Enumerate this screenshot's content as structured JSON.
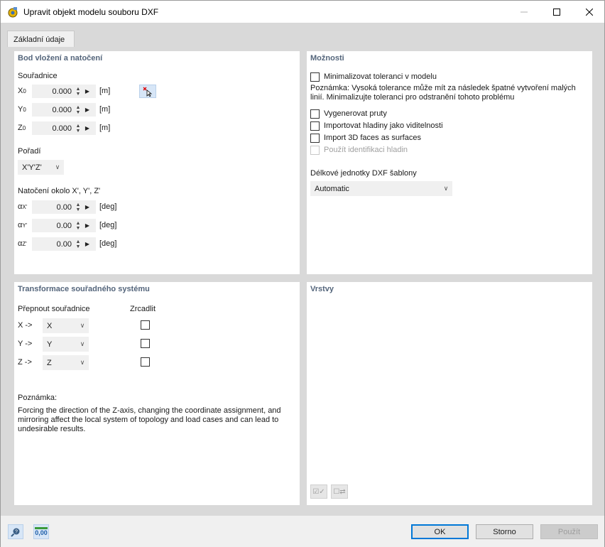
{
  "window": {
    "title": "Upravit objekt modelu souboru DXF",
    "tab": "Základní údaje"
  },
  "insert": {
    "title": "Bod vložení a natočení",
    "coords_label": "Souřadnice",
    "coords": [
      {
        "axis": "X",
        "sub": "0",
        "value": "0.000",
        "unit": "[m]"
      },
      {
        "axis": "Y",
        "sub": "0",
        "value": "0.000",
        "unit": "[m]"
      },
      {
        "axis": "Z",
        "sub": "0",
        "value": "0.000",
        "unit": "[m]"
      }
    ],
    "order_label": "Pořadí",
    "order_value": "X'Y'Z'",
    "rotation_label": "Natočení okolo X', Y', Z'",
    "rotations": [
      {
        "axis": "α",
        "sub": "X'",
        "value": "0.00",
        "unit": "[deg]"
      },
      {
        "axis": "α",
        "sub": "Y'",
        "value": "0.00",
        "unit": "[deg]"
      },
      {
        "axis": "α",
        "sub": "Z'",
        "value": "0.00",
        "unit": "[deg]"
      }
    ]
  },
  "options": {
    "title": "Možnosti",
    "minimize": "Minimalizovat toleranci v modelu",
    "note": "Poznámka: Vysoká tolerance může mít za následek špatné vytvoření malých linií. Minimalizujte toleranci pro odstranění tohoto problému",
    "gen_members": "Vygenerovat pruty",
    "import_layers": "Importovat hladiny jako viditelnosti",
    "import_3d": "Import 3D faces as surfaces",
    "use_layer_id": "Použít identifikaci hladin",
    "units_label": "Délkové jednotky DXF šablony",
    "units_value": "Automatic"
  },
  "transform": {
    "title": "Transformace souřadného systému",
    "switch_label": "Přepnout souřadnice",
    "mirror_label": "Zrcadlit",
    "rows": [
      {
        "label": "X ->",
        "value": "X"
      },
      {
        "label": "Y ->",
        "value": "Y"
      },
      {
        "label": "Z ->",
        "value": "Z"
      }
    ],
    "note_label": "Poznámka:",
    "note_text": "Forcing the direction of the Z-axis, changing the coordinate assignment, and mirroring affect the local system of topology and load cases and can lead to undesirable results."
  },
  "layers": {
    "title": "Vrstvy"
  },
  "footer": {
    "ok": "OK",
    "cancel": "Storno",
    "apply": "Použít",
    "units_icon_text": "0,00"
  }
}
